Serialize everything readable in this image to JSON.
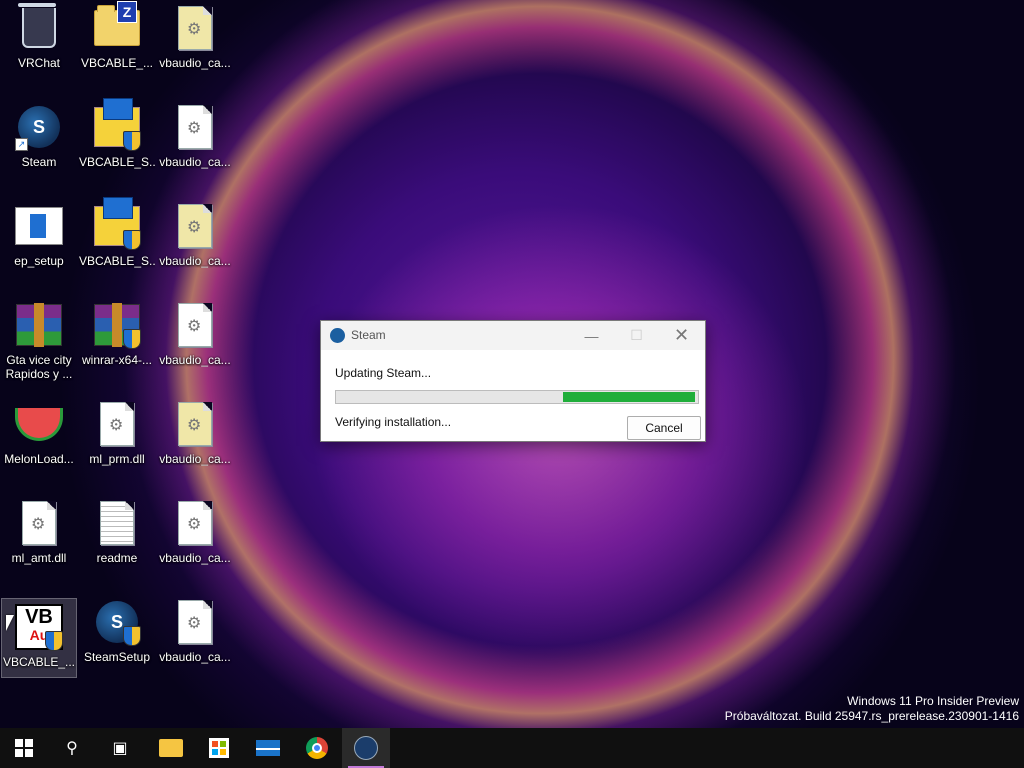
{
  "desktop": {
    "icons": [
      {
        "label": "VRChat"
      },
      {
        "label": "VBCABLE_..."
      },
      {
        "label": "vbaudio_ca..."
      },
      {
        "label": "Steam"
      },
      {
        "label": "VBCABLE_S..."
      },
      {
        "label": "vbaudio_ca..."
      },
      {
        "label": "ep_setup"
      },
      {
        "label": "VBCABLE_S..."
      },
      {
        "label": "vbaudio_ca..."
      },
      {
        "label": "Gta vice city Rapidos y ..."
      },
      {
        "label": "winrar-x64-..."
      },
      {
        "label": "vbaudio_ca..."
      },
      {
        "label": "MelonLoad..."
      },
      {
        "label": "ml_prm.dll"
      },
      {
        "label": "vbaudio_ca..."
      },
      {
        "label": "ml_amt.dll"
      },
      {
        "label": "readme"
      },
      {
        "label": "vbaudio_ca..."
      },
      {
        "label": "VBCABLE_..."
      },
      {
        "label": "SteamSetup"
      },
      {
        "label": "vbaudio_ca..."
      }
    ],
    "vb_icon_text": {
      "top": "VB",
      "bottom": "Au"
    }
  },
  "dialog": {
    "title": "Steam",
    "status": "Updating Steam...",
    "substatus": "Verifying installation...",
    "progress": 0.37,
    "cancel_label": "Cancel",
    "progress_color": "#1fae3a",
    "buttons": {
      "minimize": "—",
      "maximize": "☐",
      "close": "✕"
    }
  },
  "watermark": {
    "line1": "Windows 11 Pro Insider Preview",
    "line2": "Próbaváltozat. Build 25947.rs_prerelease.230901-1416"
  },
  "taskbar": {
    "items": [
      "start-icon",
      "search-icon",
      "task-view-icon",
      "file-explorer-icon",
      "store-icon",
      "mail-icon",
      "chrome-icon",
      "steam-icon"
    ],
    "active": "steam-icon"
  }
}
